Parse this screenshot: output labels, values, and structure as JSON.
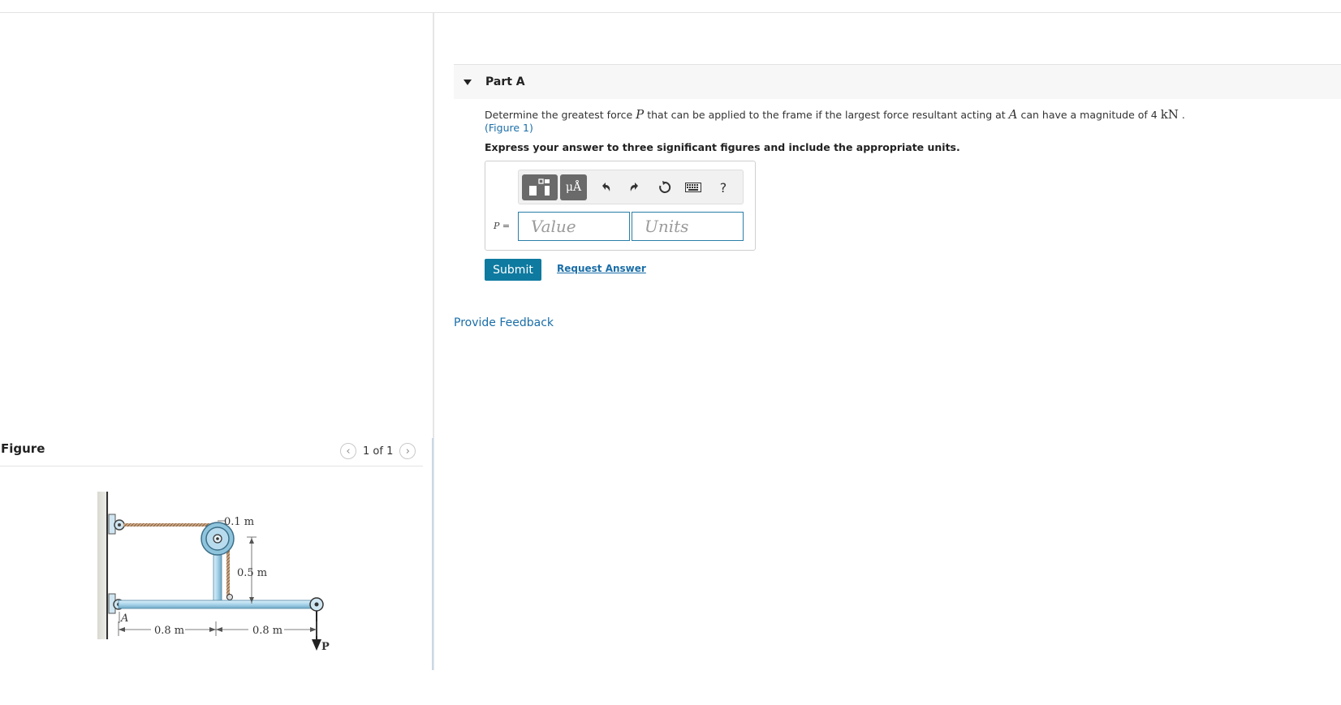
{
  "figure": {
    "title": "Figure",
    "counter": "1 of 1",
    "prev_icon": "chevron-left-icon",
    "next_icon": "chevron-right-icon",
    "labels": {
      "dim_top": "0.1 m",
      "dim_vertical": "0.5 m",
      "dim_left": "0.8 m",
      "dim_right": "0.8 m",
      "point_a": "A",
      "force_p": "P"
    }
  },
  "part": {
    "label": "Part A",
    "question_pre": "Determine the greatest force ",
    "question_var": "P",
    "question_mid": " that can be applied to the frame if the largest force resultant acting at ",
    "question_var2": "A",
    "question_post": " can have a magnitude of 4 ",
    "question_unit": "kN",
    "question_end": " .",
    "figure_link": "(Figure 1)",
    "instruction": "Express your answer to three significant figures and include the appropriate units."
  },
  "toolbar": {
    "templates_icon": "templates-icon",
    "units_symbol": "μÅ",
    "undo_icon": "undo-icon",
    "redo_icon": "redo-icon",
    "reset_icon": "reset-icon",
    "keyboard_icon": "keyboard-icon",
    "help_label": "?"
  },
  "answer": {
    "variable": "P",
    "equals": " =",
    "value_placeholder": "Value",
    "units_placeholder": "Units"
  },
  "actions": {
    "submit": "Submit",
    "request_answer": "Request Answer",
    "provide_feedback": "Provide Feedback"
  },
  "colors": {
    "accent": "#0e7aa0",
    "link": "#1a6ea8",
    "field_border": "#2a7ea8",
    "member": "#a8d4ea"
  }
}
